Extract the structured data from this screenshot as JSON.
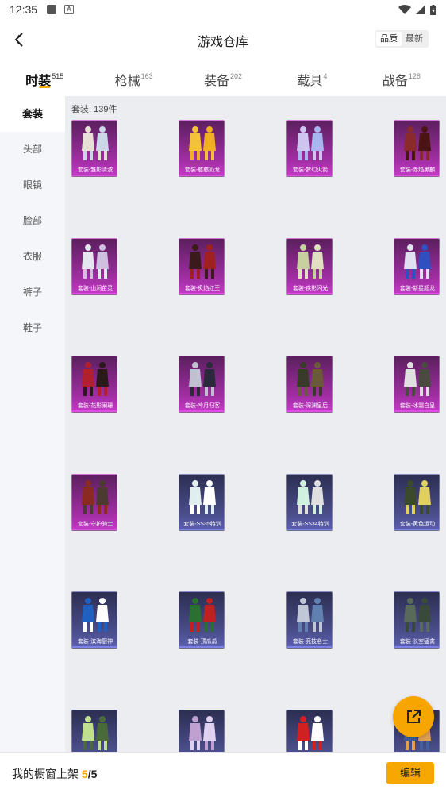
{
  "status_bar": {
    "time": "12:35"
  },
  "header": {
    "title": "游戏仓库",
    "sort_options": [
      "品质",
      "最新"
    ]
  },
  "tabs": [
    {
      "label": "时装",
      "count": "515",
      "active": true
    },
    {
      "label": "枪械",
      "count": "163",
      "active": false
    },
    {
      "label": "装备",
      "count": "202",
      "active": false
    },
    {
      "label": "载具",
      "count": "4",
      "active": false
    },
    {
      "label": "战备",
      "count": "128",
      "active": false
    }
  ],
  "sidebar": {
    "items": [
      "套装",
      "头部",
      "眼镜",
      "脸部",
      "衣服",
      "裤子",
      "鞋子"
    ]
  },
  "content": {
    "count_label": "套装: 139件",
    "items": [
      {
        "name": "套装-雏影清波",
        "tier": "purple"
      },
      {
        "name": "套装-憨憨奶龙",
        "tier": "purple"
      },
      {
        "name": "套装-梦幻火箭",
        "tier": "purple"
      },
      {
        "name": "套装-赤焰黑麟",
        "tier": "purple"
      },
      {
        "name": "套装-山涧苗灵",
        "tier": "purple"
      },
      {
        "name": "套装-炙焰红王",
        "tier": "purple"
      },
      {
        "name": "套装-疾影闪光",
        "tier": "purple"
      },
      {
        "name": "套装-新星超龙",
        "tier": "purple"
      },
      {
        "name": "套装-花影阑珊",
        "tier": "purple"
      },
      {
        "name": "套装-吟月归客",
        "tier": "purple"
      },
      {
        "name": "套装-深渊皇后",
        "tier": "purple"
      },
      {
        "name": "套装-冰霜白皇",
        "tier": "purple"
      },
      {
        "name": "套装-守护骑士",
        "tier": "purple"
      },
      {
        "name": "套装-SS35特训",
        "tier": "blue"
      },
      {
        "name": "套装-SS34特训",
        "tier": "blue"
      },
      {
        "name": "套装-黄色运动",
        "tier": "blue"
      },
      {
        "name": "套装-滨海厨神",
        "tier": "blue"
      },
      {
        "name": "套装-顶瓜瓜",
        "tier": "blue"
      },
      {
        "name": "套装-竞技名士",
        "tier": "blue"
      },
      {
        "name": "套装-长空猛禽",
        "tier": "blue"
      },
      {
        "name": "",
        "tier": "blue"
      },
      {
        "name": "",
        "tier": "blue"
      },
      {
        "name": "",
        "tier": "blue"
      },
      {
        "name": "",
        "tier": "blue"
      }
    ]
  },
  "bottom_bar": {
    "label": "我的橱窗上架",
    "shown": "5",
    "separator": "/",
    "total": "5",
    "edit_label": "编辑"
  },
  "colors": {
    "accent": "#f7a800",
    "purple_tier": "#c43ac7",
    "blue_tier": "#5b5fb0"
  }
}
